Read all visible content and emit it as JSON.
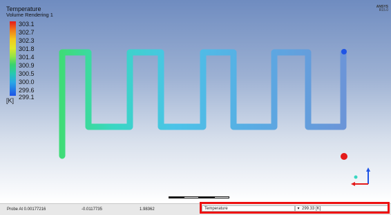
{
  "legend": {
    "title": "Temperature",
    "subtitle": "Volume Rendering 1",
    "ticks": [
      "303.1",
      "302.7",
      "302.3",
      "301.8",
      "301.4",
      "300.9",
      "300.5",
      "300.0",
      "299.6",
      "299.1"
    ],
    "unit": "[K]"
  },
  "brand": {
    "text": "ANSYS",
    "subtext": "R15.0"
  },
  "colors": {
    "hot": "#e41a1a",
    "cold": "#1e54e6",
    "highlight": "#ee1010"
  },
  "icons": {
    "axes": "axis-triad-icon"
  },
  "status": {
    "probe_label": "Probe At 0.00177216",
    "coord_y": "-0.0117735",
    "coord_z": "1.98362",
    "variable": "Temperature",
    "value": "299.33 [K]"
  }
}
